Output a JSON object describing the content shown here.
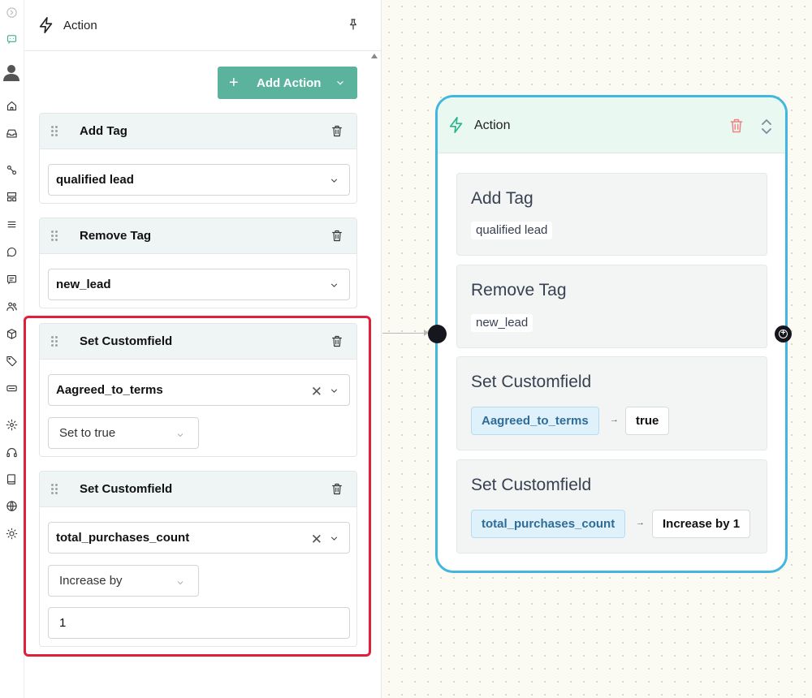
{
  "panel": {
    "title": "Action",
    "add_action_label": "Add Action",
    "cards": [
      {
        "title": "Add Tag",
        "select_value": "qualified lead"
      },
      {
        "title": "Remove Tag",
        "select_value": "new_lead"
      },
      {
        "title": "Set Customfield",
        "field_value": "Aagreed_to_terms",
        "operation": "Set to true"
      },
      {
        "title": "Set Customfield",
        "field_value": "total_purchases_count",
        "operation": "Increase by",
        "amount": "1"
      }
    ]
  },
  "node": {
    "title": "Action",
    "sections": [
      {
        "title": "Add Tag",
        "chip": "qualified lead"
      },
      {
        "title": "Remove Tag",
        "chip": "new_lead"
      },
      {
        "title": "Set Customfield",
        "field": "Aagreed_to_terms",
        "arrow": "→",
        "value": "true"
      },
      {
        "title": "Set Customfield",
        "field": "total_purchases_count",
        "arrow": "→",
        "value": "Increase by 1"
      }
    ]
  },
  "colors": {
    "primary_button": "#5bb39e",
    "node_border": "#41b6df",
    "node_header": "#eaf8f2",
    "highlight_border": "#e0203a",
    "field_chip": "#dff1fb"
  },
  "icons": {
    "rail": [
      "expand-icon",
      "chat-bot-icon",
      "user-avatar-icon",
      "home-icon",
      "inbox-icon",
      "flow-icon",
      "layout-icon",
      "list-icon",
      "chat-icon",
      "message-icon",
      "contacts-icon",
      "box-icon",
      "tag-icon",
      "keyboard-icon",
      "settings-icon",
      "headset-icon",
      "book-icon",
      "globe-icon",
      "sun-icon"
    ]
  }
}
